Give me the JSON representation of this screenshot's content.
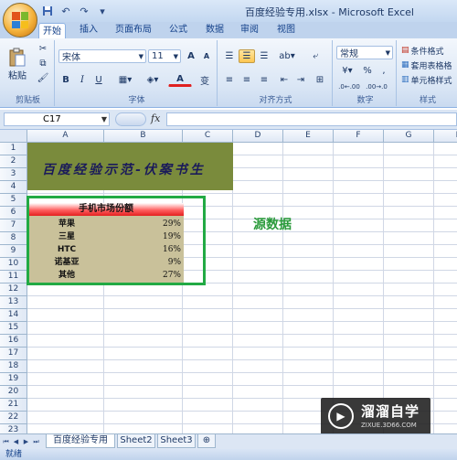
{
  "window": {
    "title": "百度经验专用.xlsx - Microsoft Excel"
  },
  "quick_access": [
    "save-icon",
    "undo-icon",
    "redo-icon",
    "customize-icon"
  ],
  "tabs": [
    {
      "label": "开始",
      "active": true
    },
    {
      "label": "插入"
    },
    {
      "label": "页面布局"
    },
    {
      "label": "公式"
    },
    {
      "label": "数据"
    },
    {
      "label": "审阅"
    },
    {
      "label": "视图"
    }
  ],
  "ribbon": {
    "clipboard": {
      "paste_label": "粘贴",
      "group_label": "剪贴板"
    },
    "font": {
      "font_name": "宋体",
      "font_size": "11",
      "grow": "A",
      "shrink": "A",
      "bold": "B",
      "italic": "I",
      "underline": "U",
      "font_color": "A",
      "phonetic": "变",
      "group_label": "字体"
    },
    "alignment": {
      "group_label": "对齐方式"
    },
    "number": {
      "format": "常规",
      "percent": "%",
      "comma": ",",
      "group_label": "数字"
    },
    "styles": {
      "cond_format": "条件格式",
      "table_format": "套用表格格",
      "cell_styles": "单元格样式",
      "group_label": "样式"
    }
  },
  "formula_bar": {
    "name_box": "C17",
    "fx": "fx",
    "formula": ""
  },
  "columns": [
    "A",
    "B",
    "C",
    "D",
    "E",
    "F",
    "G",
    "H"
  ],
  "rows": [
    "1",
    "2",
    "3",
    "4",
    "5",
    "6",
    "7",
    "8",
    "9",
    "10",
    "11",
    "12",
    "13",
    "14",
    "15",
    "16",
    "17",
    "18",
    "19",
    "20",
    "21",
    "22",
    "23"
  ],
  "banner_text": "百度经验示范-伏案书生",
  "table": {
    "title": "手机市场份额",
    "rows": [
      {
        "name": "苹果",
        "value": "29%"
      },
      {
        "name": "三星",
        "value": "19%"
      },
      {
        "name": "HTC",
        "value": "16%"
      },
      {
        "name": "诺基亚",
        "value": "9%"
      },
      {
        "name": "其他",
        "value": "27%"
      }
    ]
  },
  "source_label": "源数据",
  "watermark": {
    "title": "溜溜自学",
    "sub": "ZIXUE.3D66.COM"
  },
  "sheets": [
    {
      "label": "百度经验专用",
      "active": true
    },
    {
      "label": "Sheet2"
    },
    {
      "label": "Sheet3"
    }
  ],
  "status": "就绪"
}
